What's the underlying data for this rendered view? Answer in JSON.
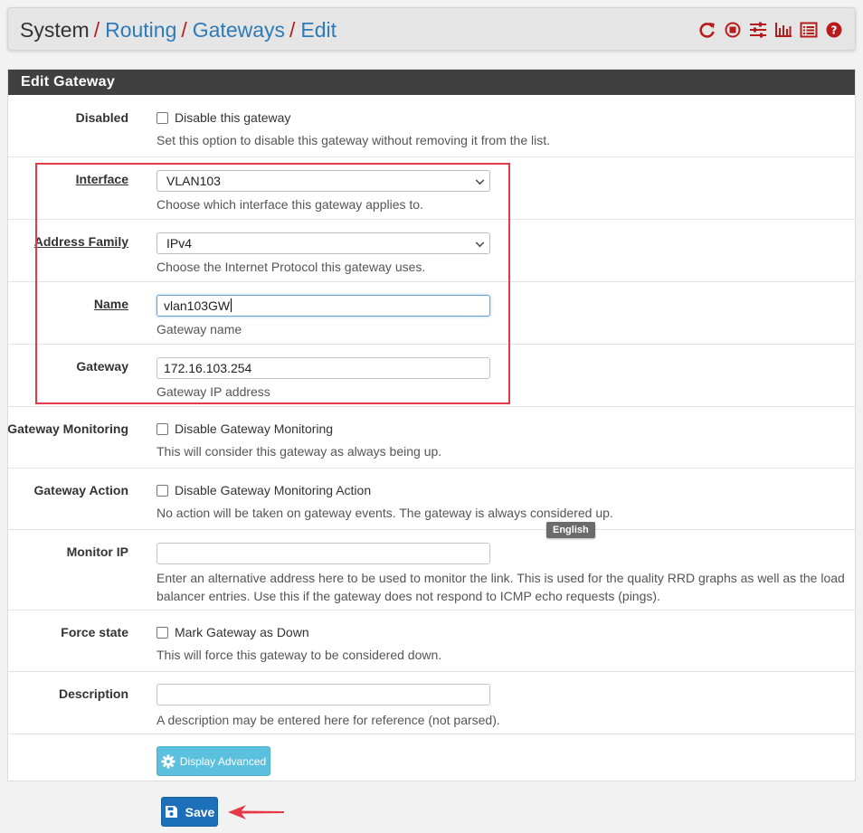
{
  "breadcrumb": {
    "root": "System",
    "items": [
      "Routing",
      "Gateways",
      "Edit"
    ],
    "separator": "/"
  },
  "toolbar": {
    "icons": [
      "refresh-icon",
      "stop-icon",
      "sliders-icon",
      "chart-icon",
      "list-icon",
      "help-icon"
    ],
    "color": "#b71c1c"
  },
  "panel": {
    "title": "Edit Gateway"
  },
  "form": {
    "disabled": {
      "label": "Disabled",
      "checkbox_label": "Disable this gateway",
      "help": "Set this option to disable this gateway without removing it from the list.",
      "checked": false
    },
    "interface": {
      "label": "Interface",
      "value": "VLAN103",
      "help": "Choose which interface this gateway applies to."
    },
    "address_family": {
      "label": "Address Family",
      "value": "IPv4",
      "help": "Choose the Internet Protocol this gateway uses."
    },
    "name": {
      "label": "Name",
      "value": "vlan103GW",
      "help": "Gateway name"
    },
    "gateway": {
      "label": "Gateway",
      "value": "172.16.103.254",
      "help": "Gateway IP address"
    },
    "gateway_monitoring": {
      "label": "Gateway Monitoring",
      "checkbox_label": "Disable Gateway Monitoring",
      "help": "This will consider this gateway as always being up.",
      "checked": false
    },
    "gateway_action": {
      "label": "Gateway Action",
      "checkbox_label": "Disable Gateway Monitoring Action",
      "help": "No action will be taken on gateway events. The gateway is always considered up.",
      "checked": false
    },
    "monitor_ip": {
      "label": "Monitor IP",
      "value": "",
      "help_line1": "Enter an alternative address here to be used to monitor the link. This is used for the quality RRD graphs as well as the load",
      "help_line2": "balancer entries. Use this if the gateway does not respond to ICMP echo requests (pings)."
    },
    "force_state": {
      "label": "Force state",
      "checkbox_label": "Mark Gateway as Down",
      "help": "This will force this gateway to be considered down.",
      "checked": false
    },
    "description": {
      "label": "Description",
      "value": "",
      "help": "A description may be entered here for reference (not parsed)."
    },
    "display_advanced_label": "Display Advanced"
  },
  "tooltip": {
    "text": "English"
  },
  "save_label": "Save",
  "colors": {
    "link": "#2f7ab8",
    "heading_bg": "#404040",
    "highlight": "#e53944",
    "save_btn": "#1c6fb8",
    "advanced_btn": "#5bc0de"
  }
}
